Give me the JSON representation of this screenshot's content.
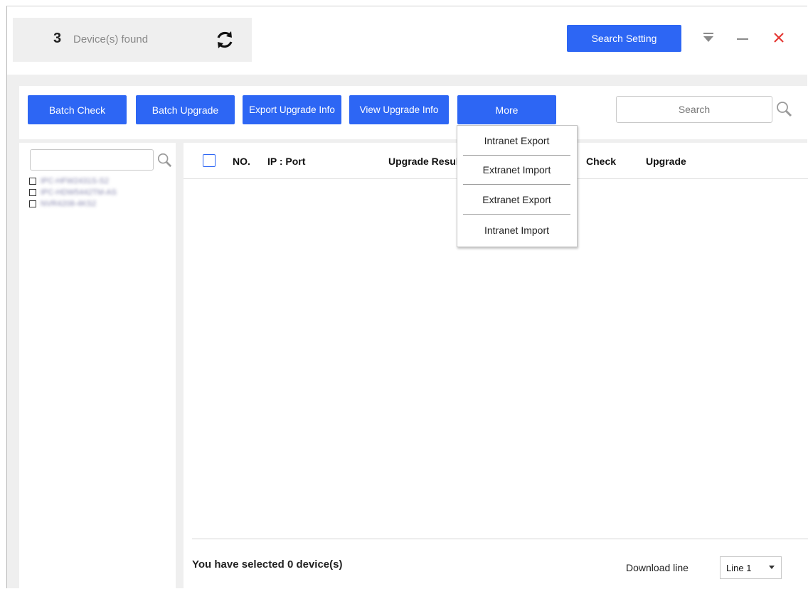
{
  "header": {
    "device_count": "3",
    "device_found_label": "Device(s) found",
    "search_setting_label": "Search Setting"
  },
  "toolbar": {
    "batch_check": "Batch Check",
    "batch_upgrade": "Batch Upgrade",
    "export_upgrade_info": "Export Upgrade Info",
    "view_upgrade_info": "View Upgrade Info",
    "more": "More",
    "search_placeholder": "Search"
  },
  "more_menu": {
    "items": [
      "Intranet Export",
      "Extranet Import",
      "Extranet Export",
      "Intranet Import"
    ]
  },
  "device_tree": {
    "search_value": "",
    "items": [
      {
        "label": "IPC-HFW2431S-S2",
        "checked": false
      },
      {
        "label": "IPC-HDW5442TM-AS",
        "checked": false
      },
      {
        "label": "NVR4208-4KS2",
        "checked": false
      }
    ]
  },
  "table": {
    "columns": {
      "no": "NO.",
      "ip_port": "IP : Port",
      "upgrade_result": "Upgrade Result",
      "check": "Check",
      "upgrade": "Upgrade"
    },
    "rows": []
  },
  "footer": {
    "selected_text": "You have selected 0  device(s)",
    "download_line_label": "Download line",
    "download_line_value": "Line 1"
  },
  "colors": {
    "accent": "#2d66f4",
    "close": "#e53935"
  }
}
